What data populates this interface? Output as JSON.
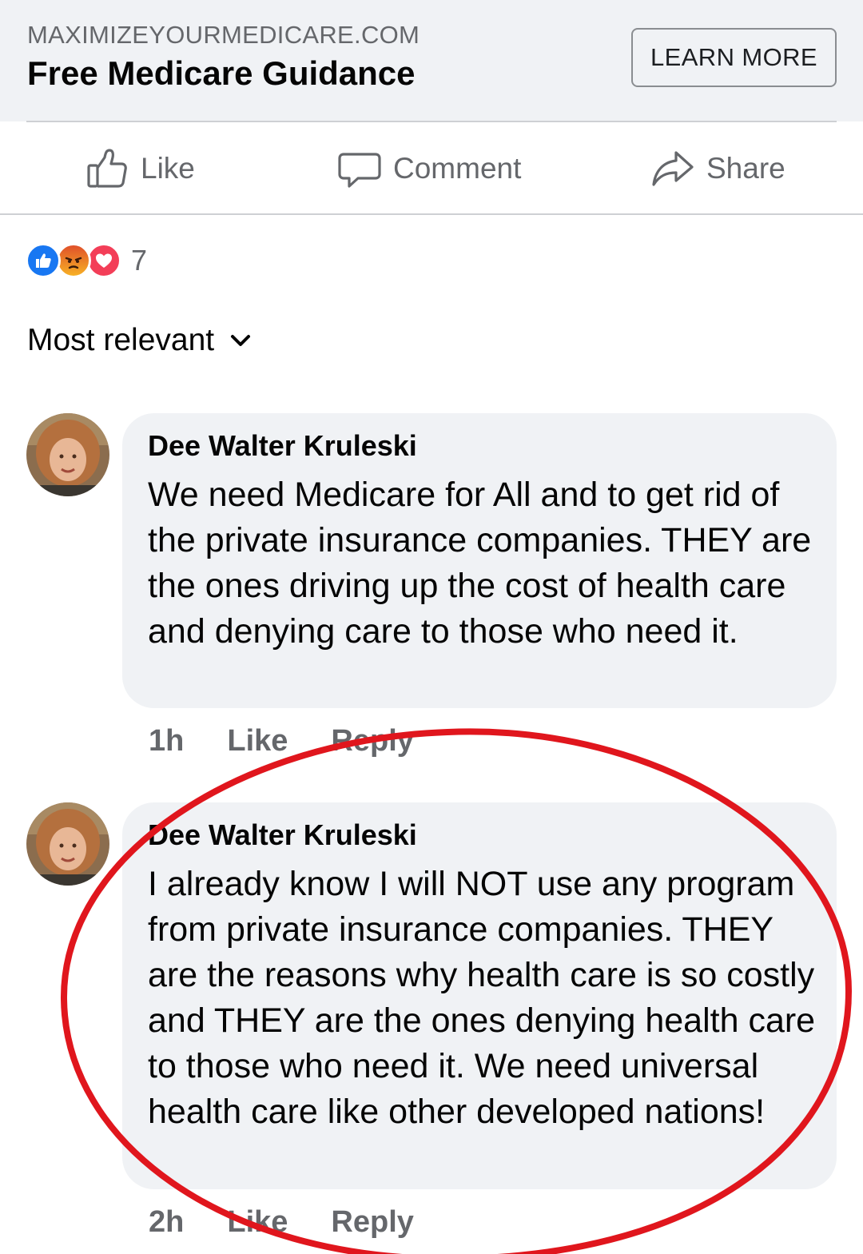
{
  "ad": {
    "domain": "MAXIMIZEYOURMEDICARE.COM",
    "title": "Free Medicare Guidance",
    "cta": "LEARN MORE"
  },
  "actions": {
    "like": "Like",
    "comment": "Comment",
    "share": "Share"
  },
  "reactions": {
    "count": "7",
    "types": [
      "like",
      "angry",
      "love"
    ]
  },
  "sort": {
    "label": "Most relevant"
  },
  "comments": [
    {
      "author": "Dee Walter Kruleski",
      "text": "We need Medicare for All and to get rid of the private insurance companies. THEY are the ones driving up the cost of health care and denying care to those who need it.",
      "time": "1h",
      "like": "Like",
      "reply": "Reply"
    },
    {
      "author": "Dee Walter Kruleski",
      "text": "I already know I will NOT use any program from private insurance companies. THEY are the reasons why health care is so costly and THEY are the ones denying health care to those who need it. We need universal health care like other developed nations!",
      "time": "2h",
      "like": "Like",
      "reply": "Reply"
    }
  ],
  "colors": {
    "background": "#ffffff",
    "banner": "#f0f2f5",
    "bubble": "#f0f2f5",
    "secondary_text": "#65676b",
    "like_blue": "#1877f2",
    "love_red": "#f33e58",
    "annotation_red": "#e0161d"
  }
}
